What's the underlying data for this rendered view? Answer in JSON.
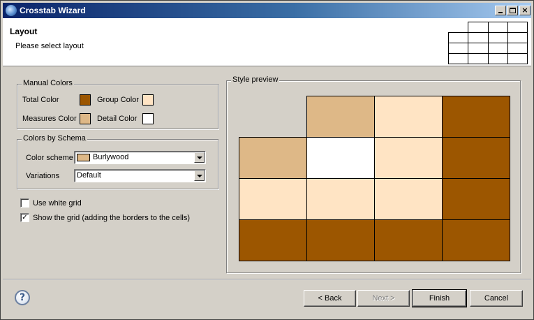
{
  "window": {
    "title": "Crosstab Wizard",
    "minimize": "_",
    "maximize": "□",
    "close": "×"
  },
  "header": {
    "title": "Layout",
    "description": "Please select layout"
  },
  "manual_colors": {
    "title": "Manual Colors",
    "total_label": "Total Color",
    "total_color": "#9c5600",
    "group_label": "Group Color",
    "group_color": "#ffe4c4",
    "measures_label": "Measures Color",
    "measures_color": "#deb887",
    "detail_label": "Detail Color",
    "detail_color": "#ffffff"
  },
  "colors_by_schema": {
    "title": "Colors by Schema",
    "scheme_label": "Color scheme",
    "scheme_value": "Burlywood",
    "scheme_swatch": "#deb887",
    "variations_label": "Variations",
    "variations_value": "Default"
  },
  "options": {
    "use_white_grid": {
      "label": "Use white grid",
      "checked": false
    },
    "show_grid": {
      "label": "Show the grid (adding the borders to the cells)",
      "checked": true,
      "mark": "✓"
    }
  },
  "preview": {
    "title": "Style preview",
    "rows": [
      [
        null,
        "#deb887",
        "#ffe4c4",
        "#9c5600"
      ],
      [
        "#deb887",
        "#ffffff",
        "#ffe4c4",
        "#9c5600"
      ],
      [
        "#ffe4c4",
        "#ffe4c4",
        "#ffe4c4",
        "#9c5600"
      ],
      [
        "#9c5600",
        "#9c5600",
        "#9c5600",
        "#9c5600"
      ]
    ]
  },
  "buttons": {
    "help": "?",
    "back": "< Back",
    "next": "Next >",
    "finish": "Finish",
    "cancel": "Cancel"
  }
}
